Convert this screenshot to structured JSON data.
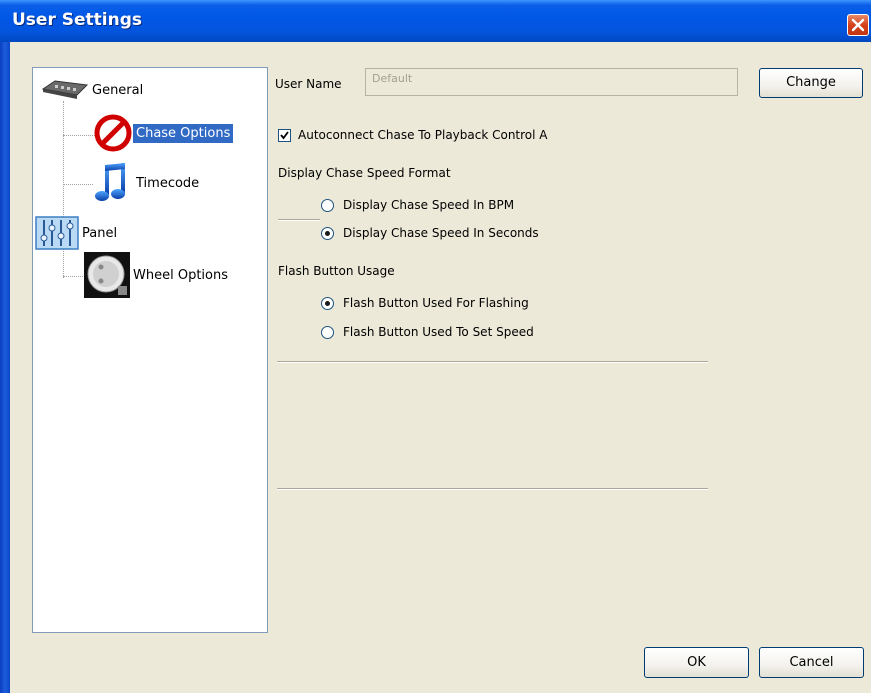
{
  "window": {
    "title": "User Settings"
  },
  "tree": {
    "items": [
      {
        "label": "General",
        "icon": "console-icon",
        "selected": false
      },
      {
        "label": "Chase Options",
        "icon": "no-entry-icon",
        "selected": true
      },
      {
        "label": "Timecode",
        "icon": "music-note-icon",
        "selected": false
      },
      {
        "label": "Panel",
        "icon": "faders-icon",
        "selected": false
      },
      {
        "label": "Wheel Options",
        "icon": "wheel-icon",
        "selected": false
      }
    ]
  },
  "user": {
    "label": "User Name",
    "value": "Default",
    "change_label": "Change"
  },
  "autoconnect": {
    "label": "Autoconnect Chase To Playback Control A",
    "checked": true
  },
  "speed_format": {
    "heading": "Display Chase Speed Format",
    "options": [
      {
        "label": "Display Chase Speed In BPM",
        "selected": false
      },
      {
        "label": "Display Chase Speed In Seconds",
        "selected": true
      }
    ]
  },
  "flash": {
    "heading": "Flash Button Usage",
    "options": [
      {
        "label": "Flash Button Used For Flashing",
        "selected": true
      },
      {
        "label": "Flash Button Used To Set Speed",
        "selected": false
      }
    ]
  },
  "footer": {
    "ok_label": "OK",
    "cancel_label": "Cancel"
  }
}
